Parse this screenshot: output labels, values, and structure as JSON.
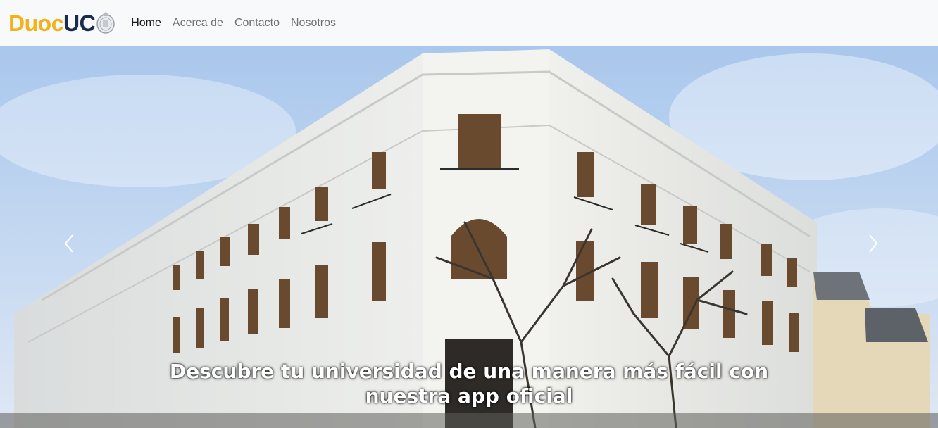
{
  "brand": {
    "part1": "Duoc",
    "part2": "UC",
    "part1_color": "#f3b21a",
    "part2_color": "#1a2b4c"
  },
  "nav": {
    "items": [
      {
        "label": "Home",
        "active": true
      },
      {
        "label": "Acerca de",
        "active": false
      },
      {
        "label": "Contacto",
        "active": false
      },
      {
        "label": "Nosotros",
        "active": false
      }
    ]
  },
  "hero": {
    "caption_line1": "Descubre tu universidad de una manera más fácil con",
    "caption_line2": "nuestra app oficial",
    "prev_icon": "chevron-left-icon",
    "next_icon": "chevron-right-icon"
  }
}
